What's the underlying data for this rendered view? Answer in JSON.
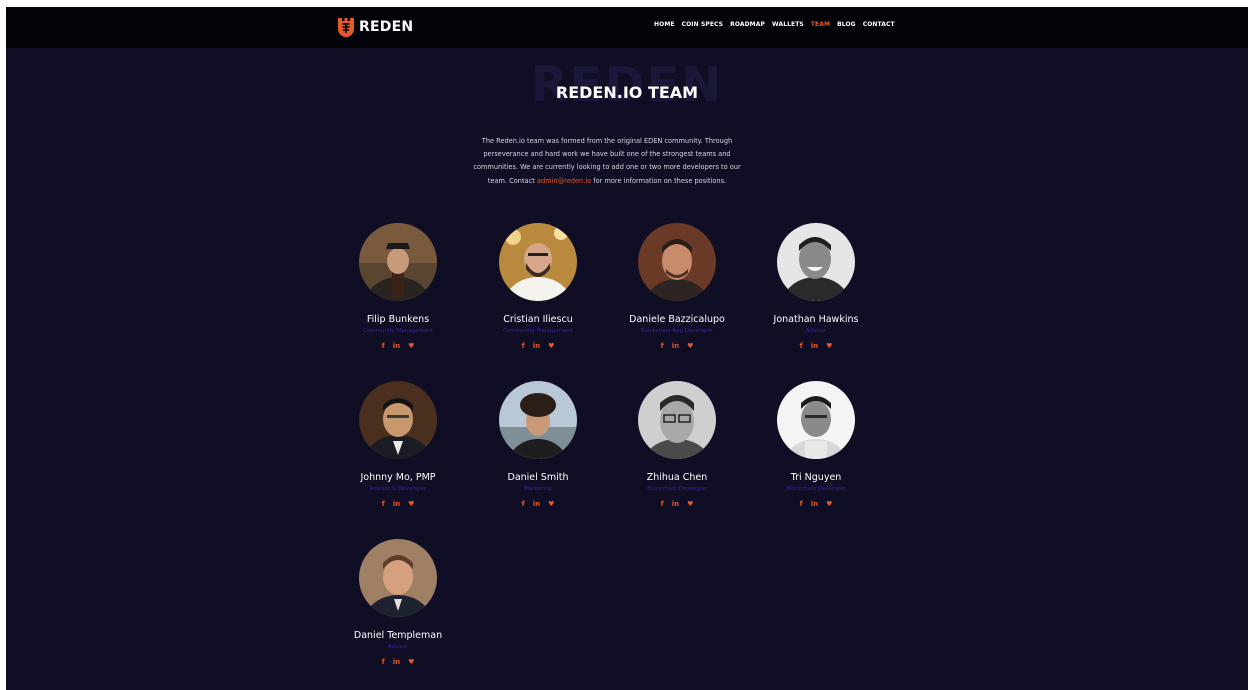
{
  "brand": {
    "name": "REDEN"
  },
  "nav": {
    "items": [
      {
        "label": "HOME"
      },
      {
        "label": "COIN SPECS"
      },
      {
        "label": "ROADMAP"
      },
      {
        "label": "WALLETS"
      },
      {
        "label": "TEAM",
        "active": true
      },
      {
        "label": "BLOG"
      },
      {
        "label": "CONTACT"
      }
    ]
  },
  "hero": {
    "ghost_text": "REDEN",
    "title": "REDEN.IO TEAM",
    "intro_before": "The Reden.io team was formed from the original EDEN community. Through perseverance and hard work we have built one of the strongest teams and communities. We are currently looking to add one or two more developers to our team. Contact ",
    "intro_email": "admin@reden.io",
    "intro_after": " for more information on these positions."
  },
  "social_labels": {
    "facebook": "f",
    "linkedin": "in",
    "twitter": "♥"
  },
  "team": [
    {
      "name": "Filip Bunkens",
      "role": "Community Management"
    },
    {
      "name": "Cristian Iliescu",
      "role": "Community Management"
    },
    {
      "name": "Daniele Bazzicalupo",
      "role": "Blockchain App Developer"
    },
    {
      "name": "Jonathan Hawkins",
      "role": "Advisor"
    },
    {
      "name": "Johnny Mo, PMP",
      "role": "Advisor & Developer"
    },
    {
      "name": "Daniel Smith",
      "role": "Marketing"
    },
    {
      "name": "Zhihua Chen",
      "role": "Blockchain Developer"
    },
    {
      "name": "Tri Nguyen",
      "role": "Blockchain Developer"
    },
    {
      "name": "Daniel Templeman",
      "role": "Advisor"
    }
  ],
  "colors": {
    "background": "#0f0e25",
    "navbar": "#03030a",
    "accent": "#e25a2b",
    "role_text": "#3d1eb8"
  }
}
